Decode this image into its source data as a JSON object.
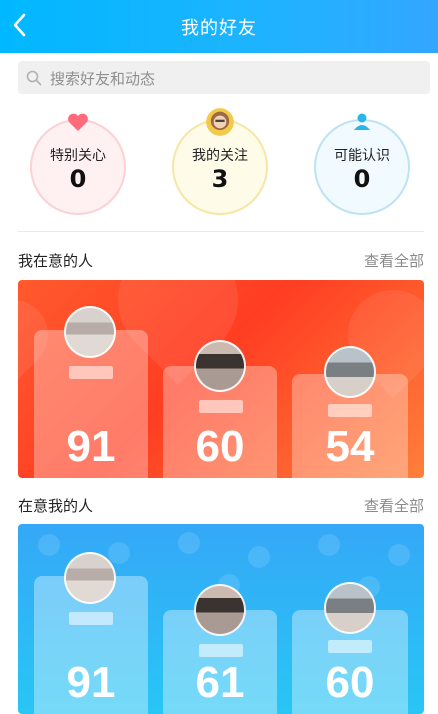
{
  "header": {
    "title": "我的好友",
    "back_icon": "chevron-left-icon"
  },
  "search": {
    "placeholder": "搜索好友和动态",
    "icon": "search-icon"
  },
  "categories": [
    {
      "label": "特别关心",
      "count": "0",
      "icon": "heart-icon",
      "accent": "#ff6b7a"
    },
    {
      "label": "我的关注",
      "count": "3",
      "icon": "avatar-icon",
      "accent": "#f1c84b"
    },
    {
      "label": "可能认识",
      "count": "0",
      "icon": "person-icon",
      "accent": "#2bb5e6"
    }
  ],
  "sections": [
    {
      "title": "我在意的人",
      "see_all": "查看全部",
      "theme": "#ff4b2b",
      "people": [
        {
          "score": "91"
        },
        {
          "score": "60"
        },
        {
          "score": "54"
        }
      ]
    },
    {
      "title": "在意我的人",
      "see_all": "查看全部",
      "theme": "#2fb7f6",
      "people": [
        {
          "score": "91"
        },
        {
          "score": "61"
        },
        {
          "score": "60"
        }
      ]
    }
  ]
}
